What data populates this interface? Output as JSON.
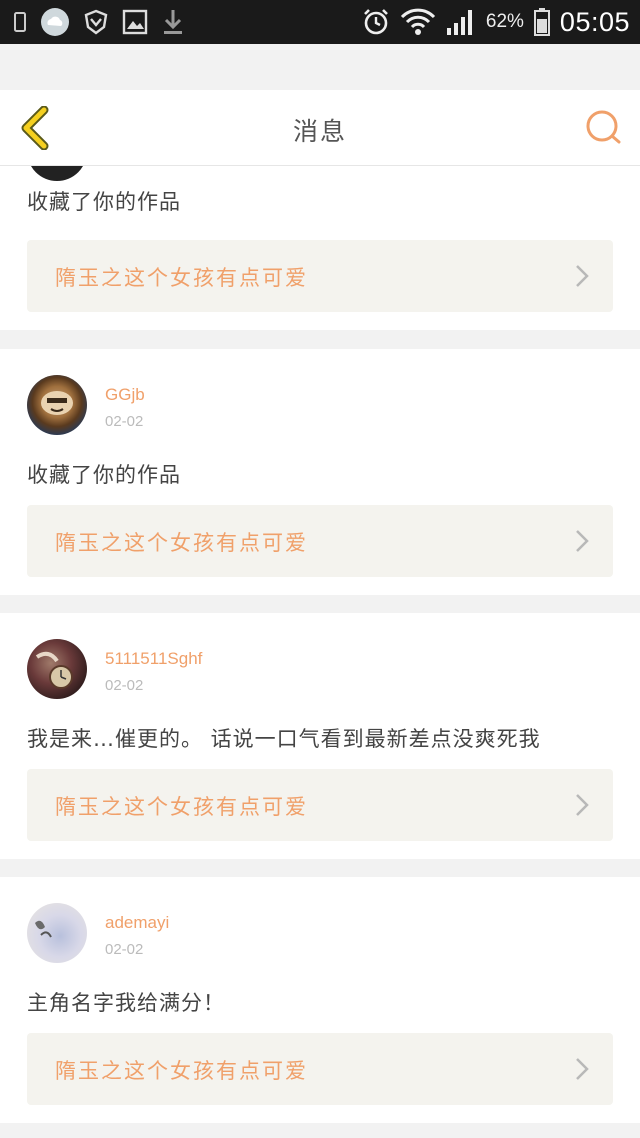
{
  "status_bar": {
    "battery_percent": "62%",
    "time": "05:05"
  },
  "header": {
    "title": "消息"
  },
  "colors": {
    "accent": "#f0a06a",
    "back_arrow": "#f5d020",
    "card_link_bg": "#f4f3ee"
  },
  "messages": [
    {
      "user": "",
      "date": "",
      "text": "收藏了你的作品",
      "work_title": "隋玉之这个女孩有点可爱"
    },
    {
      "user": "GGjb",
      "date": "02-02",
      "text": "收藏了你的作品",
      "work_title": "隋玉之这个女孩有点可爱"
    },
    {
      "user": "5111511Sghf",
      "date": "02-02",
      "text": "我是来…催更的。 话说一口气看到最新差点没爽死我",
      "work_title": "隋玉之这个女孩有点可爱"
    },
    {
      "user": "ademayi",
      "date": "02-02",
      "text": "主角名字我给满分！",
      "work_title": "隋玉之这个女孩有点可爱"
    }
  ]
}
